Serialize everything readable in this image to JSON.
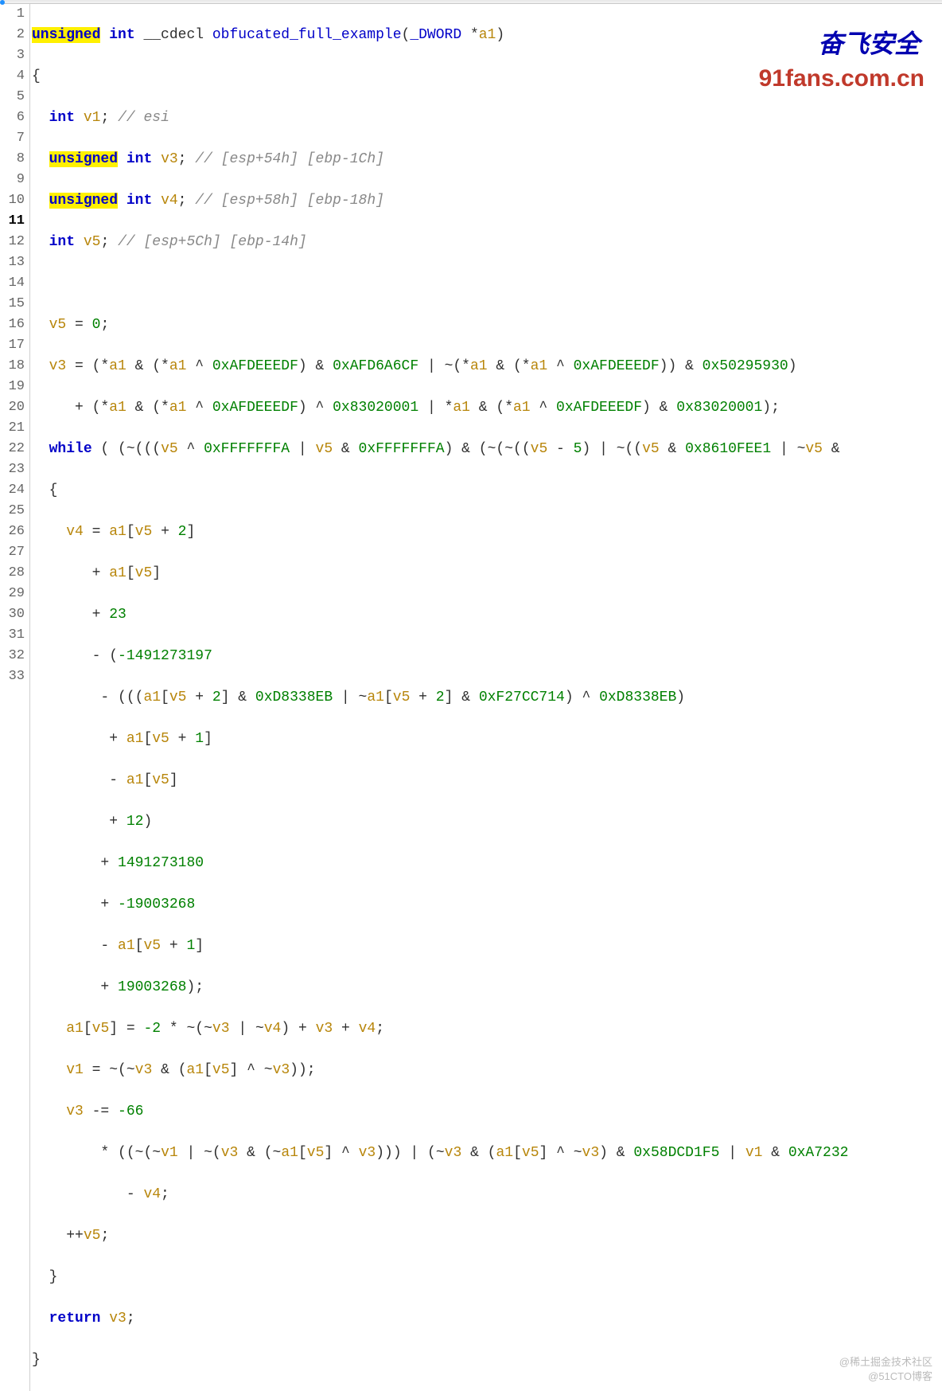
{
  "watermarks": {
    "top_cn": "奋飞安全",
    "url": "91fans.com.cn",
    "bottom1": "@稀土掘金技术社区",
    "bottom2": "@51CTO博客"
  },
  "current_line": 11,
  "line_count": 33,
  "tokens": {
    "unsigned": "unsigned",
    "int": "int",
    "cdecl": " __cdecl ",
    "func": "obfucated_full_example",
    "p1": "(",
    "p2": ")",
    "dword": "_DWORD ",
    "star": "*",
    "a1": "a1",
    "lb": "{",
    "rb": "}",
    "semi": ";",
    "sp": " ",
    "sp2": "  ",
    "sp4": "    ",
    "sp5": "     ",
    "sp6": "      ",
    "sp7": "       ",
    "sp8": "        ",
    "sp9": "         ",
    "sp11": "           ",
    "sp13": "             ",
    "v1": "v1",
    "v3": "v3",
    "v4": "v4",
    "v5": "v5",
    "c1": "// esi",
    "c2": "// [esp+54h] [ebp-1Ch]",
    "c3": "// [esp+58h] [ebp-18h]",
    "c4": "// [esp+5Ch] [ebp-14h]",
    "eq": " = ",
    "zero": "0",
    "amp": " & ",
    "xor": " ^ ",
    "or": " | ",
    "not": "~",
    "plus": " + ",
    "pplus": "+ ",
    "minus": " - ",
    "mminus": "- ",
    "n_AFDEEEDF": "0xAFDEEEDF",
    "n_AFD6A6CF": "0xAFD6A6CF",
    "n_50295930": "0x50295930",
    "n_83020001": "0x83020001",
    "while": "while",
    "n_FFFFFFFA": "0xFFFFFFFA",
    "n_5": "5",
    "n_8610FEE1": "0x8610FEE1",
    "lbr": "[",
    "rbr": "]",
    "n_2": "2",
    "n_23": "23",
    "n_1491273197": "-1491273197",
    "n_D8338EB": "0xD8338EB",
    "n_F27CC714": "0xF27CC714",
    "n_1": "1",
    "n_12": "12",
    "n_1491273180": "1491273180",
    "n_m19003268": "-19003268",
    "n_19003268": "19003268",
    "n_m2": "-2",
    "times": " * ",
    "meq": " -= ",
    "n_m66": "-66",
    "n_58DCD1F5": "0x58DCD1F5",
    "n_A7232": "0xA7232",
    "inc": "++",
    "return": "return"
  }
}
